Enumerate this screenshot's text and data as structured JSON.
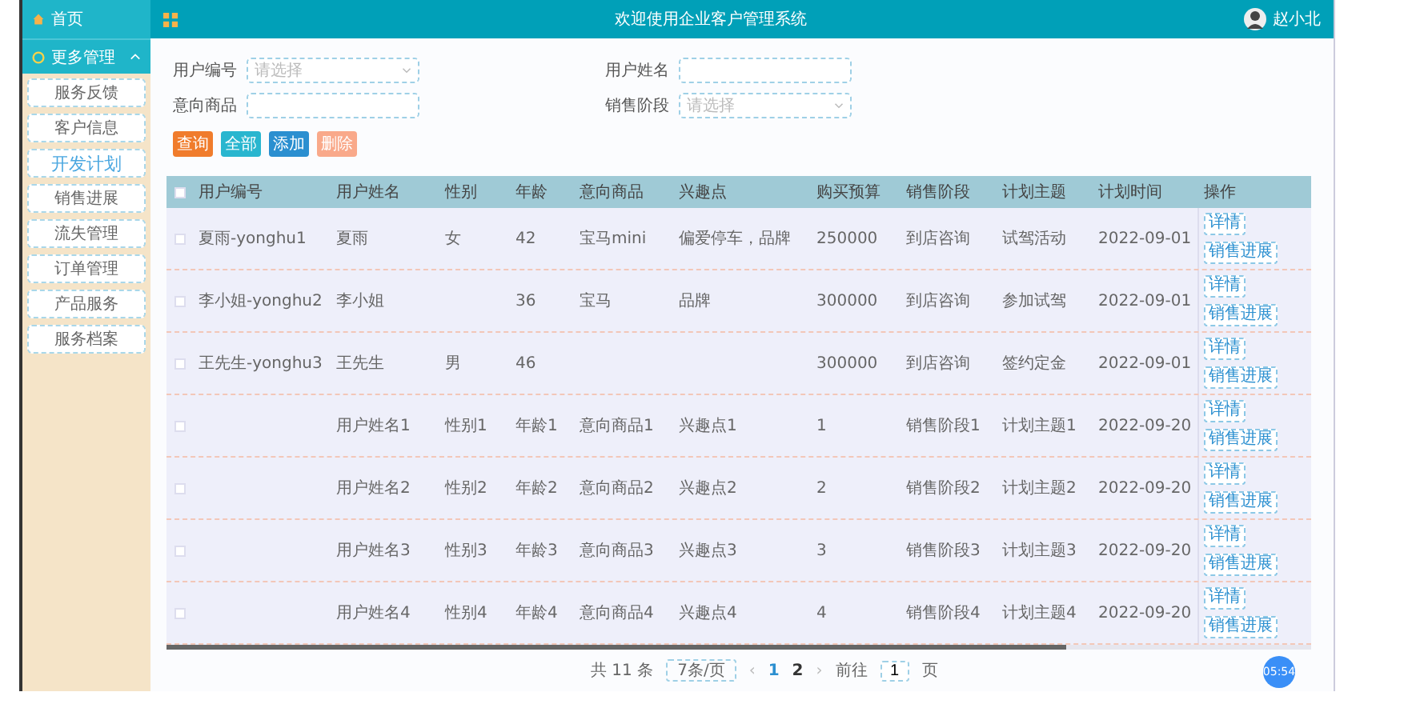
{
  "sidebar": {
    "home": "首页",
    "group": {
      "label": "更多管理",
      "expanded": true
    },
    "items": [
      {
        "label": "服务反馈",
        "selected": false
      },
      {
        "label": "客户信息",
        "selected": false
      },
      {
        "label": "开发计划",
        "selected": true
      },
      {
        "label": "销售进展",
        "selected": false
      },
      {
        "label": "流失管理",
        "selected": false
      },
      {
        "label": "订单管理",
        "selected": false
      },
      {
        "label": "产品服务",
        "selected": false
      },
      {
        "label": "服务档案",
        "selected": false
      }
    ]
  },
  "header": {
    "title": "欢迎使用企业客户管理系统",
    "user": "赵小北"
  },
  "search": {
    "fields": [
      {
        "label": "用户编号",
        "kind": "select",
        "placeholder": "请选择"
      },
      {
        "label": "用户姓名",
        "kind": "input"
      },
      {
        "label": "意向商品",
        "kind": "input"
      },
      {
        "label": "销售阶段",
        "kind": "select",
        "placeholder": "请选择"
      }
    ],
    "buttons": [
      {
        "label": "查询",
        "kind": "search"
      },
      {
        "label": "全部",
        "kind": "all"
      },
      {
        "label": "添加",
        "kind": "add"
      },
      {
        "label": "删除",
        "kind": "delete"
      }
    ]
  },
  "table": {
    "select_all": {
      "checked": false
    },
    "columns": [
      "用户编号",
      "用户姓名",
      "性别",
      "年龄",
      "意向商品",
      "兴趣点",
      "购买预算",
      "销售阶段",
      "计划主题",
      "计划时间",
      "操作"
    ],
    "rows": [
      {
        "checked": false,
        "cells": [
          "夏雨-yonghu1",
          "夏雨",
          "女",
          "42",
          "宝马mini",
          "偏爱停车，品牌",
          "250000",
          "到店咨询",
          "试驾活动",
          "2022-09-01"
        ],
        "actions": [
          "详情",
          "销售进展"
        ]
      },
      {
        "checked": false,
        "cells": [
          "李小姐-yonghu2",
          "李小姐",
          null,
          "36",
          "宝马",
          "品牌",
          "300000",
          "到店咨询",
          "参加试驾",
          "2022-09-01"
        ],
        "actions": [
          "详情",
          "销售进展"
        ]
      },
      {
        "checked": false,
        "cells": [
          "王先生-yonghu3",
          "王先生",
          "男",
          "46",
          null,
          null,
          "300000",
          "到店咨询",
          "签约定金",
          "2022-09-01"
        ],
        "actions": [
          "详情",
          "销售进展"
        ]
      },
      {
        "checked": false,
        "cells": [
          null,
          "用户姓名1",
          "性别1",
          "年龄1",
          "意向商品1",
          "兴趣点1",
          "1",
          "销售阶段1",
          "计划主题1",
          "2022-09-20"
        ],
        "actions": [
          "详情",
          "销售进展"
        ]
      },
      {
        "checked": false,
        "cells": [
          null,
          "用户姓名2",
          "性别2",
          "年龄2",
          "意向商品2",
          "兴趣点2",
          "2",
          "销售阶段2",
          "计划主题2",
          "2022-09-20"
        ],
        "actions": [
          "详情",
          "销售进展"
        ]
      },
      {
        "checked": false,
        "cells": [
          null,
          "用户姓名3",
          "性别3",
          "年龄3",
          "意向商品3",
          "兴趣点3",
          "3",
          "销售阶段3",
          "计划主题3",
          "2022-09-20"
        ],
        "actions": [
          "详情",
          "销售进展"
        ]
      },
      {
        "checked": false,
        "cells": [
          null,
          "用户姓名4",
          "性别4",
          "年龄4",
          "意向商品4",
          "兴趣点4",
          "4",
          "销售阶段4",
          "计划主题4",
          "2022-09-20"
        ],
        "actions": [
          "详情",
          "销售进展"
        ]
      }
    ]
  },
  "pagination": {
    "total": "共 11 条",
    "page_size": "7条/页",
    "prev": "‹",
    "pages": [
      {
        "label": "1",
        "selected": true
      },
      {
        "label": "2",
        "selected": false
      }
    ],
    "next": "›",
    "goto_label": "前往",
    "goto_value": "1",
    "goto_suffix": "页"
  },
  "timer_badge": "05:54"
}
